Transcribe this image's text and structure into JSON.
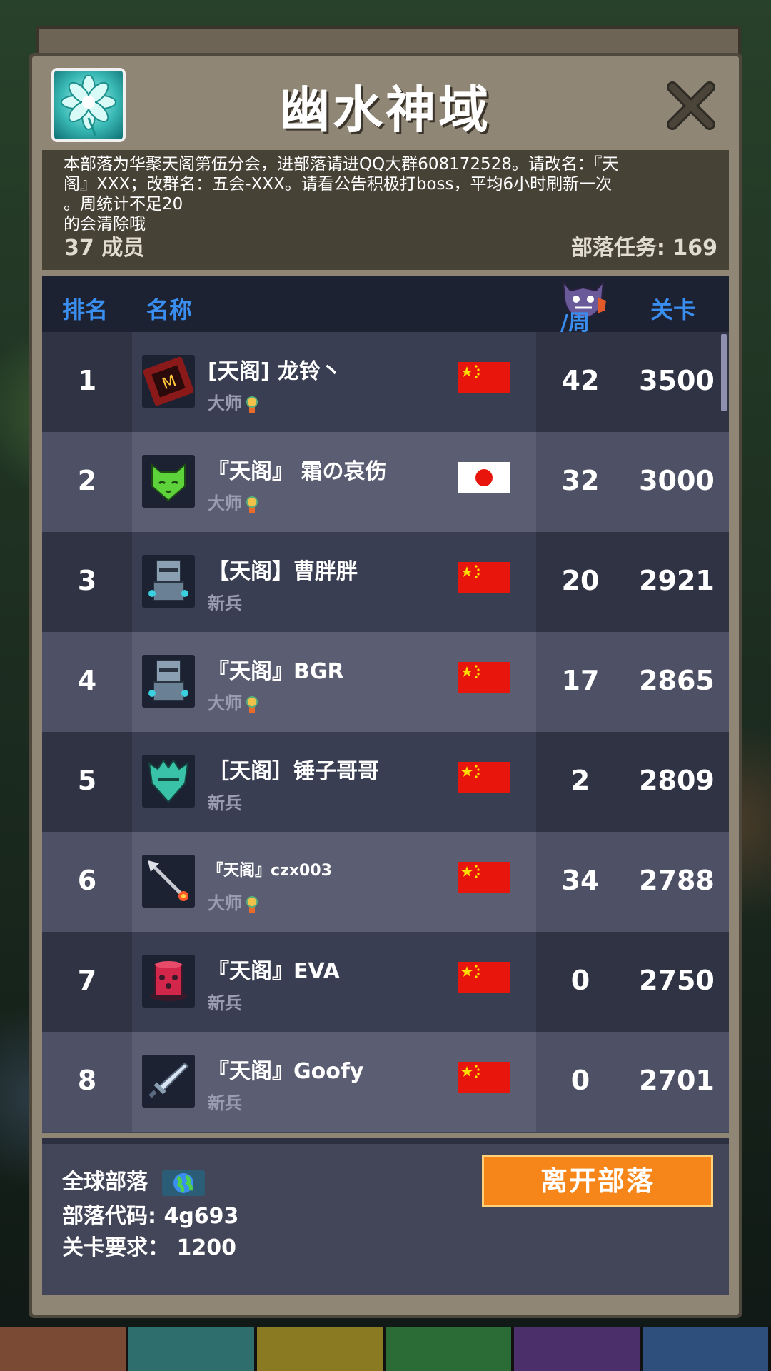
{
  "header": {
    "title": "幽水神域"
  },
  "description": {
    "text_lines": [
      "本部落为华聚天阁第伍分会，进部落请进QQ大群608172528。请改名：『天",
      "阁』XXX；改群名：五会-XXX。请看公告积极打boss，平均6小时刷新一次",
      "。周统计不足20",
      "的会清除哦"
    ],
    "member_count": "37 成员",
    "tribe_tasks": "部落任务: 169"
  },
  "table": {
    "headers": {
      "rank": "排名",
      "name": "名称",
      "week": "/周",
      "level": "关卡"
    },
    "rows": [
      {
        "rank": "1",
        "name": "[天阁] 龙铃丶",
        "role": "大师",
        "medal": true,
        "flag": "china-flag",
        "week": "42",
        "level": "3500",
        "avatar": "spellbook-icon"
      },
      {
        "rank": "2",
        "name": "『天阁』 霜の哀伤",
        "role": "大师",
        "medal": true,
        "flag": "japan-flag",
        "week": "32",
        "level": "3000",
        "avatar": "green-cat-icon"
      },
      {
        "rank": "3",
        "name": "【天阁】曹胖胖",
        "role": "新兵",
        "medal": false,
        "flag": "china-flag",
        "week": "20",
        "level": "2921",
        "avatar": "robot-knight-icon"
      },
      {
        "rank": "4",
        "name": "『天阁』BGR",
        "role": "大师",
        "medal": true,
        "flag": "china-flag",
        "week": "17",
        "level": "2865",
        "avatar": "robot-knight-icon"
      },
      {
        "rank": "5",
        "name": "［天阁］锤子哥哥",
        "role": "新兵",
        "medal": false,
        "flag": "china-flag",
        "week": "2",
        "level": "2809",
        "avatar": "teal-monster-icon"
      },
      {
        "rank": "6",
        "name": "『天阁』czx003",
        "role": "大师",
        "medal": true,
        "flag": "china-flag",
        "week": "34",
        "level": "2788",
        "avatar": "arrow-icon"
      },
      {
        "rank": "7",
        "name": "『天阁』EVA",
        "role": "新兵",
        "medal": false,
        "flag": "china-flag",
        "week": "0",
        "level": "2750",
        "avatar": "heart-hat-icon"
      },
      {
        "rank": "8",
        "name": "『天阁』Goofy",
        "role": "新兵",
        "medal": false,
        "flag": "china-flag",
        "week": "0",
        "level": "2701",
        "avatar": "sword-icon"
      }
    ]
  },
  "footer": {
    "global_tribe": "全球部落",
    "tribe_code": "部落代码: 4g693",
    "level_requirement": "关卡要求： 1200",
    "leave_button": "离开部落"
  },
  "colors": {
    "header_blue": "#3a8ef0",
    "leave_orange": "#f6861a",
    "china_red": "#e8150d",
    "star_yellow": "#ffde00"
  }
}
